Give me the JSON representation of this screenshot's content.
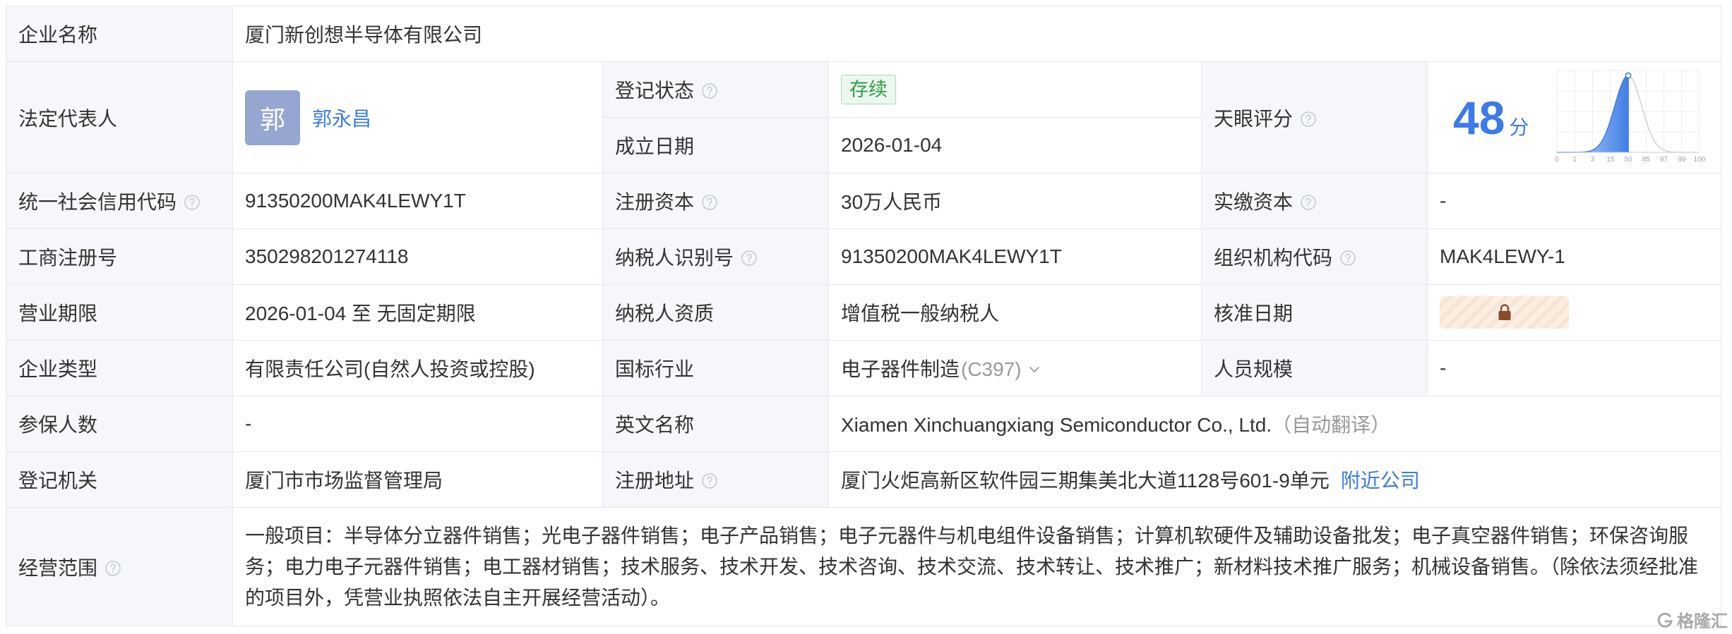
{
  "colors": {
    "label_bg": "#f5f7fa",
    "border": "#e4e7ee",
    "text": "#333333",
    "link": "#3c7ddb",
    "score": "#3b7be8",
    "muted": "#999999",
    "status_text": "#2f9e4a",
    "status_border": "#a3dbb0",
    "status_bg": "#ecf8ef",
    "avatar_bg": "#95a6d0",
    "lock": "#8a4a2b"
  },
  "icons": {
    "help": "question-circle-icon",
    "expand": "chevron-down-icon",
    "lock": "lock-icon",
    "watermark": "gelonghui-logo-icon"
  },
  "company_name": {
    "label": "企业名称",
    "value": "厦门新创想半导体有限公司"
  },
  "legal_rep": {
    "label": "法定代表人",
    "avatar": "郭",
    "name": "郭永昌"
  },
  "reg_status": {
    "label": "登记状态",
    "value": "存续"
  },
  "founded": {
    "label": "成立日期",
    "value": "2026-01-04"
  },
  "score": {
    "label": "天眼评分",
    "value": "48",
    "unit": "分",
    "scale_ticks": [
      "0",
      "1",
      "3",
      "15",
      "50",
      "85",
      "97",
      "99",
      "100"
    ],
    "marker_at": "50"
  },
  "credit_code": {
    "label": "统一社会信用代码",
    "value": "91350200MAK4LEWY1T"
  },
  "reg_capital": {
    "label": "注册资本",
    "value": "30万人民币"
  },
  "paid_capital": {
    "label": "实缴资本",
    "value": "-"
  },
  "biz_reg_no": {
    "label": "工商注册号",
    "value": "350298201274118"
  },
  "taxpayer_id": {
    "label": "纳税人识别号",
    "value": "91350200MAK4LEWY1T"
  },
  "org_code": {
    "label": "组织机构代码",
    "value": "MAK4LEWY-1"
  },
  "business_term": {
    "label": "营业期限",
    "value": "2026-01-04 至 无固定期限"
  },
  "taxpayer_qual": {
    "label": "纳税人资质",
    "value": "增值税一般纳税人"
  },
  "approval_date": {
    "label": "核准日期",
    "locked": true
  },
  "company_type": {
    "label": "企业类型",
    "value": "有限责任公司(自然人投资或控股)"
  },
  "industry": {
    "label": "国标行业",
    "value": "电子器件制造",
    "code": "(C397)"
  },
  "staff_size": {
    "label": "人员规模",
    "value": "-"
  },
  "insured": {
    "label": "参保人数",
    "value": "-"
  },
  "english_name": {
    "label": "英文名称",
    "value": "Xiamen Xinchuangxiang Semiconductor Co., Ltd.",
    "note": "（自动翻译）"
  },
  "reg_authority": {
    "label": "登记机关",
    "value": "厦门市市场监督管理局"
  },
  "address": {
    "label": "注册地址",
    "value": "厦门火炬高新区软件园三期集美北大道1128号601-9单元",
    "link": "附近公司"
  },
  "business_scope": {
    "label": "经营范围",
    "value": "一般项目：半导体分立器件销售；光电子器件销售；电子产品销售；电子元器件与机电组件设备销售；计算机软硬件及辅助设备批发；电子真空器件销售；环保咨询服务；电力电子元器件销售；电工器材销售；技术服务、技术开发、技术咨询、技术交流、技术转让、技术推广；新材料技术推广服务；机械设备销售。（除依法须经批准的项目外，凭营业执照依法自主开展经营活动）。"
  },
  "watermark": "格隆汇"
}
